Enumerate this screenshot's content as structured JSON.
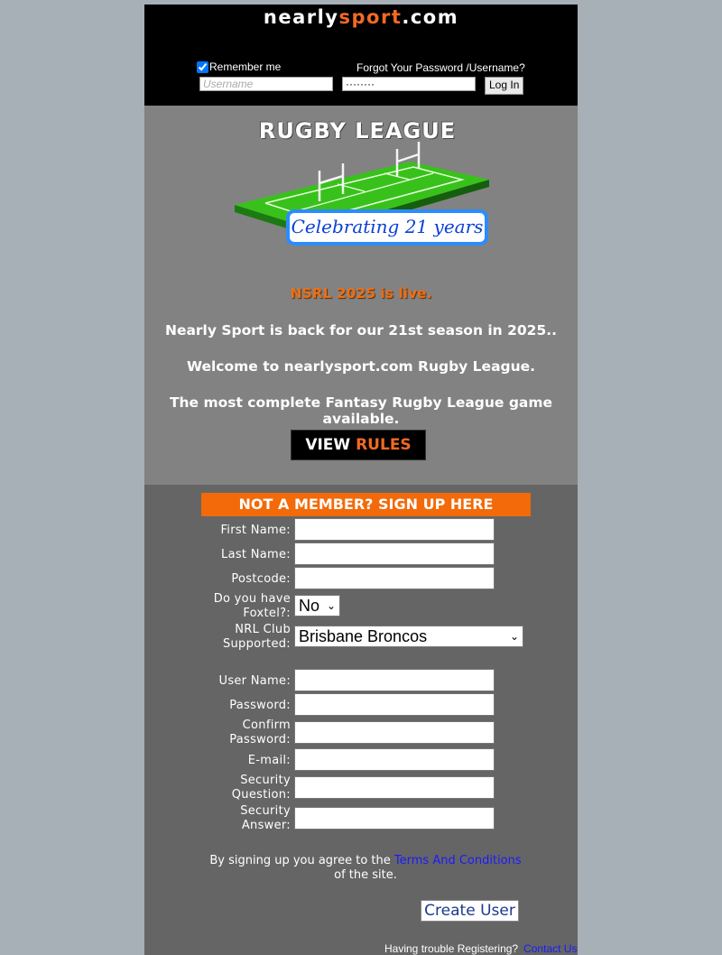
{
  "header": {
    "logo_prefix": "nearly",
    "logo_accent": "sport",
    "logo_suffix": ".com",
    "remember_label": "Remember me",
    "remember_checked": true,
    "forgot_label": "Forgot Your Password /Username?",
    "username_placeholder": "Username",
    "password_value": "········",
    "login_label": "Log In"
  },
  "banner": {
    "hero_title": "RUGBY LEAGUE",
    "celebrate": "Celebrating 21 years",
    "live": "NSRL 2025 is live.",
    "line1": "Nearly Sport is back for our 21st season in 2025..",
    "line2": "Welcome to nearlysport.com Rugby League.",
    "line3": "The most complete Fantasy Rugby League game available.",
    "rules_view": "VIEW",
    "rules_word": "RULES"
  },
  "signup": {
    "title": "NOT A MEMBER? SIGN UP HERE",
    "first_name": "First Name:",
    "last_name": "Last Name:",
    "postcode": "Postcode:",
    "foxtel_l1": "Do you have",
    "foxtel_l2": "Foxtel?:",
    "foxtel_value": "No",
    "club_l1": "NRL Club",
    "club_l2": "Supported:",
    "club_value": "Brisbane Broncos",
    "user_name": "User Name:",
    "password": "Password:",
    "confirm_l1": "Confirm",
    "confirm_l2": "Password:",
    "email": "E-mail:",
    "secq_l1": "Security",
    "secq_l2": "Question:",
    "seca_l1": "Security",
    "seca_l2": "Answer:",
    "terms_before": "By signing up you agree to the",
    "terms_link": "Terms And Conditions",
    "terms_after": "of the site.",
    "create_label": "Create User",
    "trouble_label": "Having trouble Registering?",
    "contact_label": "Contact Us"
  },
  "colors": {
    "accent": "#f26a21",
    "header_bg": "#000000",
    "banner_bg": "#828282",
    "signup_bg": "#656565",
    "link": "#1a1aff"
  }
}
